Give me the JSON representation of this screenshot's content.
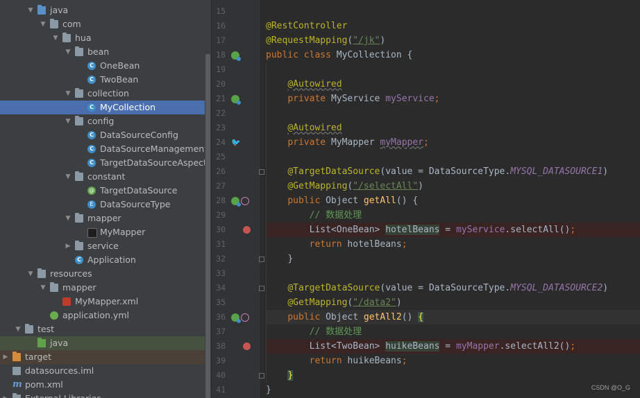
{
  "project_tree": {
    "rows": [
      {
        "label": "java",
        "icon": "folder-blue",
        "indent": 2,
        "arrow": "down"
      },
      {
        "label": "com",
        "icon": "folder",
        "indent": 3,
        "arrow": "down"
      },
      {
        "label": "hua",
        "icon": "folder",
        "indent": 4,
        "arrow": "down"
      },
      {
        "label": "bean",
        "icon": "folder",
        "indent": 5,
        "arrow": "down"
      },
      {
        "label": "OneBean",
        "icon": "class",
        "indent": 6,
        "arrow": ""
      },
      {
        "label": "TwoBean",
        "icon": "class",
        "indent": 6,
        "arrow": ""
      },
      {
        "label": "collection",
        "icon": "folder",
        "indent": 5,
        "arrow": "down"
      },
      {
        "label": "MyCollection",
        "icon": "class",
        "indent": 6,
        "arrow": "",
        "selected": true
      },
      {
        "label": "config",
        "icon": "folder",
        "indent": 5,
        "arrow": "down"
      },
      {
        "label": "DataSourceConfig",
        "icon": "class",
        "indent": 6,
        "arrow": ""
      },
      {
        "label": "DataSourceManagement",
        "icon": "class",
        "indent": 6,
        "arrow": ""
      },
      {
        "label": "TargetDataSourceAspect",
        "icon": "class",
        "indent": 6,
        "arrow": ""
      },
      {
        "label": "constant",
        "icon": "folder",
        "indent": 5,
        "arrow": "down"
      },
      {
        "label": "TargetDataSource",
        "icon": "annotation",
        "indent": 6,
        "arrow": ""
      },
      {
        "label": "DataSourceType",
        "icon": "enum",
        "indent": 6,
        "arrow": ""
      },
      {
        "label": "mapper",
        "icon": "folder",
        "indent": 5,
        "arrow": "down"
      },
      {
        "label": "MyMapper",
        "icon": "mybatis",
        "indent": 6,
        "arrow": ""
      },
      {
        "label": "service",
        "icon": "folder",
        "indent": 5,
        "arrow": "right"
      },
      {
        "label": "Application",
        "icon": "spring-class",
        "indent": 5,
        "arrow": ""
      },
      {
        "label": "resources",
        "icon": "folder-res",
        "indent": 2,
        "arrow": "down"
      },
      {
        "label": "mapper",
        "icon": "folder",
        "indent": 3,
        "arrow": "down"
      },
      {
        "label": "MyMapper.xml",
        "icon": "xml",
        "indent": 4,
        "arrow": ""
      },
      {
        "label": "application.yml",
        "icon": "yml",
        "indent": 3,
        "arrow": ""
      },
      {
        "label": "test",
        "icon": "folder",
        "indent": 1,
        "arrow": "down"
      },
      {
        "label": "java",
        "icon": "folder-green",
        "indent": 2,
        "arrow": "",
        "test": true
      },
      {
        "label": "target",
        "icon": "folder-orange",
        "indent": 0,
        "arrow": "right",
        "excluded": true
      },
      {
        "label": "datasources.iml",
        "icon": "iml",
        "indent": 0,
        "arrow": ""
      },
      {
        "label": "pom.xml",
        "icon": "maven",
        "indent": 0,
        "arrow": ""
      },
      {
        "label": "External Libraries",
        "icon": "lib",
        "indent": 0,
        "arrow": "right"
      }
    ]
  },
  "editor": {
    "lines": [
      {
        "n": "15",
        "tokens": []
      },
      {
        "n": "16",
        "tokens": [
          {
            "t": "@RestController",
            "c": "ann"
          }
        ]
      },
      {
        "n": "17",
        "tokens": [
          {
            "t": "@RequestMapping",
            "c": "ann"
          },
          {
            "t": "(",
            "c": "plain"
          },
          {
            "t": "\"/jk\"",
            "c": "strlink"
          },
          {
            "t": ")",
            "c": "plain"
          }
        ]
      },
      {
        "n": "18",
        "tokens": [
          {
            "t": "public class ",
            "c": "kw"
          },
          {
            "t": "MyCollection ",
            "c": "plain"
          },
          {
            "t": "{",
            "c": "plain"
          }
        ],
        "gutter": "spring"
      },
      {
        "n": "19",
        "tokens": []
      },
      {
        "n": "20",
        "tokens": [
          {
            "t": "    ",
            "c": "plain"
          },
          {
            "t": "@Autowired",
            "c": "ann squiggle"
          }
        ]
      },
      {
        "n": "21",
        "tokens": [
          {
            "t": "    ",
            "c": "plain"
          },
          {
            "t": "private ",
            "c": "kw"
          },
          {
            "t": "MyService ",
            "c": "plain"
          },
          {
            "t": "myService",
            "c": "field"
          },
          {
            "t": ";",
            "c": "kw"
          }
        ],
        "gutter": "spring"
      },
      {
        "n": "22",
        "tokens": []
      },
      {
        "n": "23",
        "tokens": [
          {
            "t": "    ",
            "c": "plain"
          },
          {
            "t": "@Autowired",
            "c": "ann squiggle"
          }
        ]
      },
      {
        "n": "24",
        "tokens": [
          {
            "t": "    ",
            "c": "plain"
          },
          {
            "t": "private ",
            "c": "kw"
          },
          {
            "t": "MyMapper ",
            "c": "plain"
          },
          {
            "t": "myMapper",
            "c": "field squiggle"
          },
          {
            "t": ";",
            "c": "kw"
          }
        ],
        "gutter": "mybatis"
      },
      {
        "n": "25",
        "tokens": []
      },
      {
        "n": "26",
        "tokens": [
          {
            "t": "    ",
            "c": "plain"
          },
          {
            "t": "@TargetDataSource",
            "c": "ann"
          },
          {
            "t": "(value = DataSourceType.",
            "c": "plain"
          },
          {
            "t": "MYSQL_DATASOURCE1",
            "c": "static"
          },
          {
            "t": ")",
            "c": "plain"
          }
        ],
        "fold": true
      },
      {
        "n": "27",
        "tokens": [
          {
            "t": "    ",
            "c": "plain"
          },
          {
            "t": "@GetMapping",
            "c": "ann"
          },
          {
            "t": "(",
            "c": "plain"
          },
          {
            "t": "\"/selectAll\"",
            "c": "strlink"
          },
          {
            "t": ")",
            "c": "plain"
          }
        ]
      },
      {
        "n": "28",
        "tokens": [
          {
            "t": "    ",
            "c": "plain"
          },
          {
            "t": "public ",
            "c": "kw"
          },
          {
            "t": "Object ",
            "c": "plain"
          },
          {
            "t": "getAll",
            "c": "method"
          },
          {
            "t": "() {",
            "c": "plain"
          }
        ],
        "gutter": "spring-web"
      },
      {
        "n": "29",
        "tokens": [
          {
            "t": "        ",
            "c": "plain"
          },
          {
            "t": "// 数据处理",
            "c": "comment"
          }
        ]
      },
      {
        "n": "30",
        "tokens": [
          {
            "t": "        ",
            "c": "plain"
          },
          {
            "t": "List<OneBean> ",
            "c": "plain"
          },
          {
            "t": "hotelBeans",
            "c": "plain hl"
          },
          {
            "t": " = ",
            "c": "plain"
          },
          {
            "t": "myService",
            "c": "field"
          },
          {
            "t": ".selectAll()",
            "c": "plain"
          },
          {
            "t": ";",
            "c": "kw"
          }
        ],
        "breakpoint": true
      },
      {
        "n": "31",
        "tokens": [
          {
            "t": "        ",
            "c": "plain"
          },
          {
            "t": "return ",
            "c": "kw"
          },
          {
            "t": "hotelBeans",
            "c": "plain"
          },
          {
            "t": ";",
            "c": "kw"
          }
        ]
      },
      {
        "n": "32",
        "tokens": [
          {
            "t": "    ",
            "c": "plain"
          },
          {
            "t": "}",
            "c": "plain"
          }
        ],
        "fold": true
      },
      {
        "n": "33",
        "tokens": []
      },
      {
        "n": "34",
        "tokens": [
          {
            "t": "    ",
            "c": "plain"
          },
          {
            "t": "@TargetDataSource",
            "c": "ann"
          },
          {
            "t": "(value = DataSourceType.",
            "c": "plain"
          },
          {
            "t": "MYSQL_DATASOURCE2",
            "c": "static"
          },
          {
            "t": ")",
            "c": "plain"
          }
        ],
        "fold": true
      },
      {
        "n": "35",
        "tokens": [
          {
            "t": "    ",
            "c": "plain"
          },
          {
            "t": "@GetMapping",
            "c": "ann"
          },
          {
            "t": "(",
            "c": "plain"
          },
          {
            "t": "\"/data2\"",
            "c": "strlink"
          },
          {
            "t": ")",
            "c": "plain"
          }
        ]
      },
      {
        "n": "36",
        "tokens": [
          {
            "t": "    ",
            "c": "plain"
          },
          {
            "t": "public ",
            "c": "kw"
          },
          {
            "t": "Object ",
            "c": "plain"
          },
          {
            "t": "getAll2",
            "c": "method"
          },
          {
            "t": "() ",
            "c": "plain"
          },
          {
            "t": "{",
            "c": "brace-hl"
          }
        ],
        "gutter": "spring-web",
        "current": true
      },
      {
        "n": "37",
        "tokens": [
          {
            "t": "        ",
            "c": "plain"
          },
          {
            "t": "// 数据处理",
            "c": "comment"
          }
        ]
      },
      {
        "n": "38",
        "tokens": [
          {
            "t": "        ",
            "c": "plain"
          },
          {
            "t": "List<TwoBean> ",
            "c": "plain"
          },
          {
            "t": "huikeBeans",
            "c": "plain hl"
          },
          {
            "t": " = ",
            "c": "plain"
          },
          {
            "t": "myMapper",
            "c": "field"
          },
          {
            "t": ".selectAll2()",
            "c": "plain"
          },
          {
            "t": ";",
            "c": "kw"
          }
        ],
        "breakpoint": true
      },
      {
        "n": "39",
        "tokens": [
          {
            "t": "        ",
            "c": "plain"
          },
          {
            "t": "return ",
            "c": "kw"
          },
          {
            "t": "huikeBeans",
            "c": "plain"
          },
          {
            "t": ";",
            "c": "kw"
          }
        ]
      },
      {
        "n": "40",
        "tokens": [
          {
            "t": "    ",
            "c": "plain"
          },
          {
            "t": "}",
            "c": "brace-hl"
          }
        ],
        "fold": true
      },
      {
        "n": "41",
        "tokens": [
          {
            "t": "}",
            "c": "plain"
          }
        ]
      }
    ]
  },
  "watermark": "CSDN @O_G"
}
